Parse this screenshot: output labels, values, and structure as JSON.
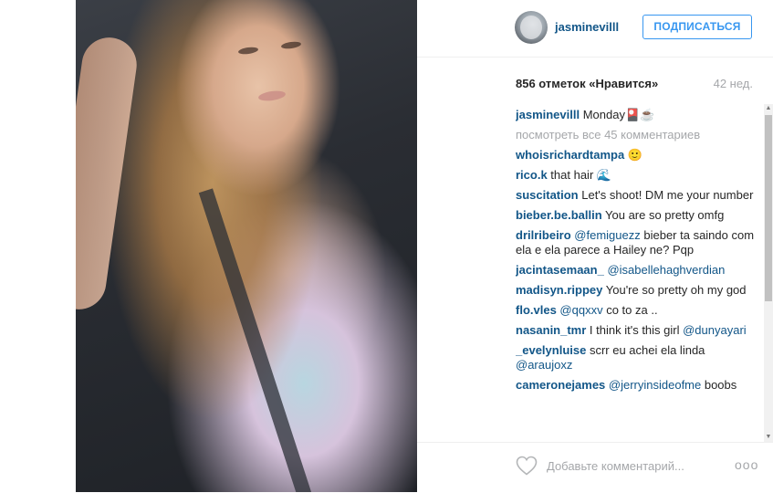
{
  "post": {
    "username": "jasminevilll",
    "follow_label": "ПОДПИСАТЬСЯ",
    "likes": "856 отметок «Нравится»",
    "time": "42 нед.",
    "caption_user": "jasminevilll",
    "caption_text": " Monday🎴☕",
    "view_all": "посмотреть все 45 комментариев",
    "add_comment_placeholder": "Добавьте комментарий...",
    "more_label": "ooo"
  },
  "comments": [
    {
      "user": "whoisrichardtampa",
      "text": " 🙂",
      "mention": ""
    },
    {
      "user": "rico.k",
      "text": " that hair 🌊",
      "mention": ""
    },
    {
      "user": "suscitation",
      "text": " Let's shoot! DM me your number",
      "mention": ""
    },
    {
      "user": "bieber.be.ballin",
      "text": " You are so pretty omfg",
      "mention": ""
    },
    {
      "user": "drilribeiro",
      "mention": " @femiguezz",
      "text": " bieber ta saindo com ela e ela parece a Hailey ne? Pqp"
    },
    {
      "user": "jacintasemaan_",
      "mention": " @isabellehaghverdian",
      "text": ""
    },
    {
      "user": "madisyn.rippey",
      "text": " You're so pretty oh my god",
      "mention": ""
    },
    {
      "user": "flo.vles",
      "mention": " @qqxxv",
      "text": " co to za .."
    },
    {
      "user": "nasanin_tmr",
      "text": " I think it's this girl ",
      "mention": "@dunyayari",
      "mention_after": true
    },
    {
      "user": "_evelynluise",
      "text": " scrr eu achei ela linda ",
      "mention": "@araujoxz",
      "mention_after": true
    },
    {
      "user": "cameronejames",
      "mention": " @jerryinsideofme",
      "text": " boobs"
    }
  ],
  "colors": {
    "link": "#125688",
    "follow": "#3897f0",
    "muted": "#a5a7aa"
  }
}
